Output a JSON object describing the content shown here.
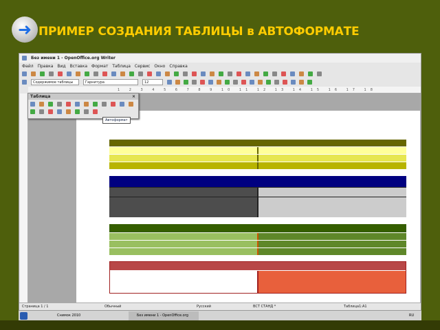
{
  "slide": {
    "title": "ПРИМЕР СОЗДАНИЯ ТАБЛИЦЫ в АВТОФОРМАТЕ",
    "icon": "arrow-right-icon"
  },
  "window": {
    "title": "Без имени 1 - OpenOffice.org Writer",
    "menu": [
      "Файл",
      "Правка",
      "Вид",
      "Вставка",
      "Формат",
      "Таблица",
      "Сервис",
      "Окно",
      "Справка"
    ],
    "style_value": "Содержимое таблицы",
    "font_value": "Гарнитура",
    "size_value": "12",
    "ruler": "1 2 3 4 5 6 7 8 9 10 11 12 13 14 15 16 17 18"
  },
  "table_toolbar": {
    "title": "Таблица",
    "tooltip": "Автоформат"
  },
  "status": {
    "page": "Страница 1 / 1",
    "style": "Обычный",
    "lang": "Русский",
    "mode": "ВСТ СТАНД *",
    "cell": "Таблица1:A1"
  },
  "taskbar": {
    "task1": "Снимок 2010",
    "task2": "Без имени 1 - OpenOffice.org Writer",
    "lang": "RU"
  },
  "tables": [
    {
      "header": "#666600",
      "left": [
        "#ffff99",
        "#e6e650",
        "#b8b400"
      ],
      "right": [
        "#ffff99",
        "#e6e650",
        "#b8b400"
      ]
    },
    {
      "header": "#000080",
      "left": [
        "#4d4d4d",
        "#4d4d4d"
      ],
      "right": [
        "#cccccc",
        "#cccccc"
      ]
    },
    {
      "header": "#355e00",
      "left": [
        "#99bf60",
        "#99bf60",
        "#99bf60"
      ],
      "right": [
        "#5e8729",
        "#5e8729",
        "#5e8729"
      ]
    },
    {
      "header": "#b84747",
      "left": [
        "#ffffff"
      ],
      "right": [
        "#e8603c"
      ]
    }
  ]
}
